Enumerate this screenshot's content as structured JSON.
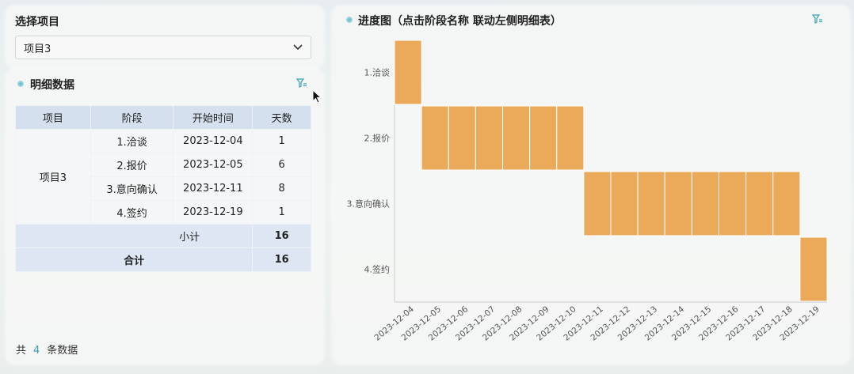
{
  "project_select": {
    "title": "选择项目",
    "selected": "项目3"
  },
  "detail": {
    "title": "明细数据",
    "headers": [
      "项目",
      "阶段",
      "开始时间",
      "天数"
    ],
    "project": "项目3",
    "rows": [
      {
        "stage": "1.洽谈",
        "start": "2023-12-04",
        "days": "1"
      },
      {
        "stage": "2.报价",
        "start": "2023-12-05",
        "days": "6"
      },
      {
        "stage": "3.意向确认",
        "start": "2023-12-11",
        "days": "8"
      },
      {
        "stage": "4.签约",
        "start": "2023-12-19",
        "days": "1"
      }
    ],
    "subtotal_label": "小计",
    "subtotal_value": "16",
    "total_label": "合计",
    "total_value": "16",
    "footer_prefix": "共",
    "footer_count": "4",
    "footer_suffix": "条数据"
  },
  "chart_panel": {
    "title": "进度图（点击阶段名称 联动左侧明细表）"
  },
  "chart_data": {
    "type": "bar",
    "orientation": "horizontal",
    "categories": [
      "1.洽谈",
      "2.报价",
      "3.意向确认",
      "4.签约"
    ],
    "x_ticks": [
      "2023-12-04",
      "2023-12-05",
      "2023-12-06",
      "2023-12-07",
      "2023-12-08",
      "2023-12-09",
      "2023-12-10",
      "2023-12-11",
      "2023-12-12",
      "2023-12-13",
      "2023-12-14",
      "2023-12-15",
      "2023-12-16",
      "2023-12-17",
      "2023-12-18",
      "2023-12-19"
    ],
    "series": [
      {
        "stage": "1.洽谈",
        "start": "2023-12-04",
        "days": 1
      },
      {
        "stage": "2.报价",
        "start": "2023-12-05",
        "days": 6
      },
      {
        "stage": "3.意向确认",
        "start": "2023-12-11",
        "days": 8
      },
      {
        "stage": "4.签约",
        "start": "2023-12-19",
        "days": 1
      }
    ],
    "bar_color": "#eba95a",
    "grid": false
  },
  "colors": {
    "accent": "#3aa0b0",
    "header_bg": "#d5e0ef",
    "bar": "#eba95a"
  }
}
